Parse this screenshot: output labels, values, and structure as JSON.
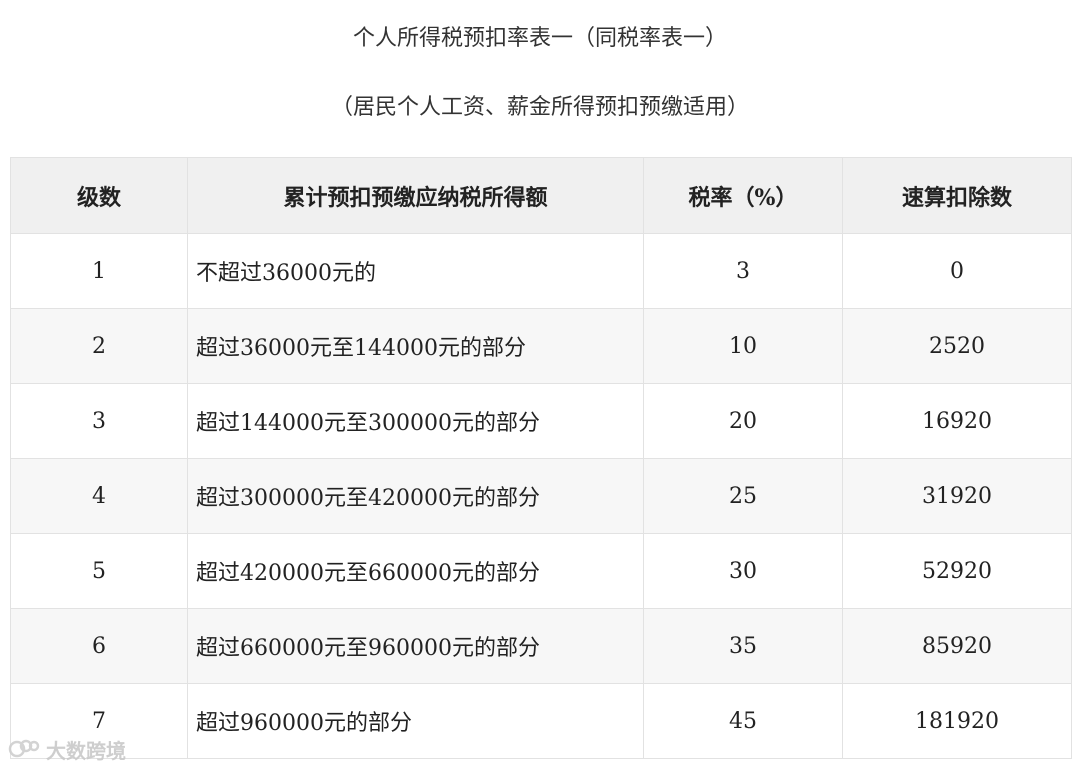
{
  "title": "个人所得税预扣率表一（同税率表一）",
  "subtitle": "（居民个人工资、薪金所得预扣预缴适用）",
  "table": {
    "headers": [
      "级数",
      "累计预扣预缴应纳税所得额",
      "税率（%）",
      "速算扣除数"
    ],
    "rows": [
      [
        "1",
        "不超过36000元的",
        "3",
        "0"
      ],
      [
        "2",
        "超过36000元至144000元的部分",
        "10",
        "2520"
      ],
      [
        "3",
        "超过144000元至300000元的部分",
        "20",
        "16920"
      ],
      [
        "4",
        "超过300000元至420000元的部分",
        "25",
        "31920"
      ],
      [
        "5",
        "超过420000元至660000元的部分",
        "30",
        "52920"
      ],
      [
        "6",
        "超过660000元至960000元的部分",
        "35",
        "85920"
      ],
      [
        "7",
        "超过960000元的部分",
        "45",
        "181920"
      ]
    ]
  },
  "watermark": {
    "text": "大数跨境",
    "icon": "link-logo-icon"
  }
}
